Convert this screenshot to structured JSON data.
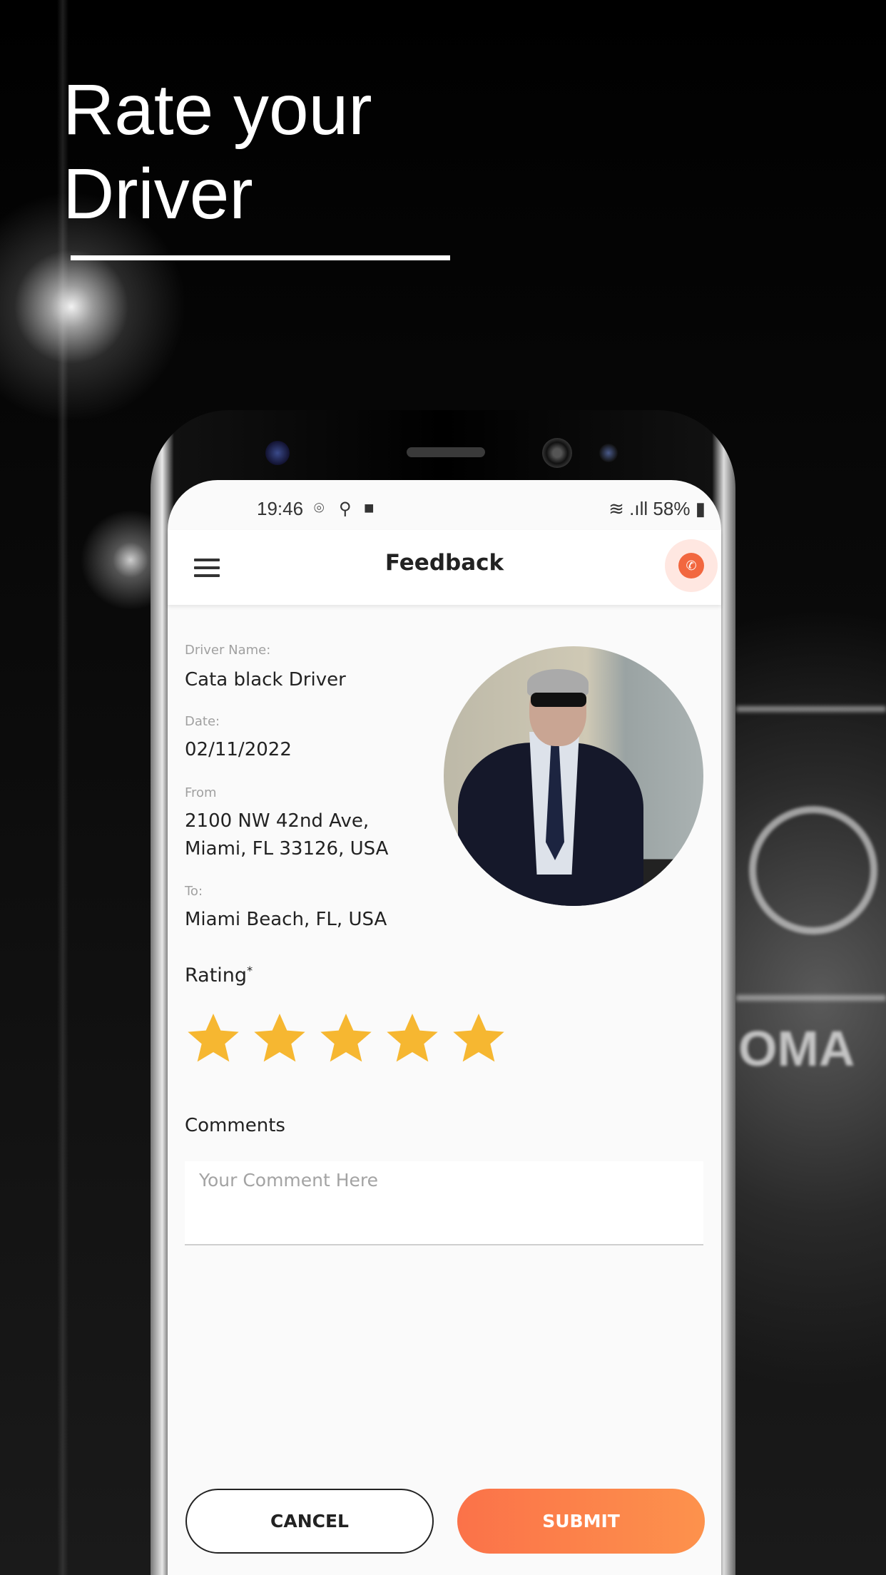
{
  "promo": {
    "headline_line1": "Rate your",
    "headline_line2": "Driver"
  },
  "background": {
    "car_text": "OMA"
  },
  "status_bar": {
    "time": "19:46",
    "battery": "58%"
  },
  "app_bar": {
    "title": "Feedback",
    "call_icon": "phone-icon",
    "menu_icon": "hamburger-icon"
  },
  "trip": {
    "driver_name_label": "Driver Name:",
    "driver_name": "Cata black Driver",
    "date_label": "Date:",
    "date": "02/11/2022",
    "from_label": "From",
    "from_line1": "2100 NW 42nd Ave,",
    "from_line2": "Miami, FL 33126, USA",
    "to_label": "To:",
    "to": "Miami Beach, FL, USA"
  },
  "rating": {
    "label": "Rating",
    "required_mark": "*",
    "value": 5,
    "max": 5,
    "star_color": "#F6B731"
  },
  "comments": {
    "label": "Comments",
    "placeholder": "Your Comment Here",
    "value": ""
  },
  "actions": {
    "cancel": "CANCEL",
    "submit": "SUBMIT",
    "accent": "#FB7249"
  }
}
